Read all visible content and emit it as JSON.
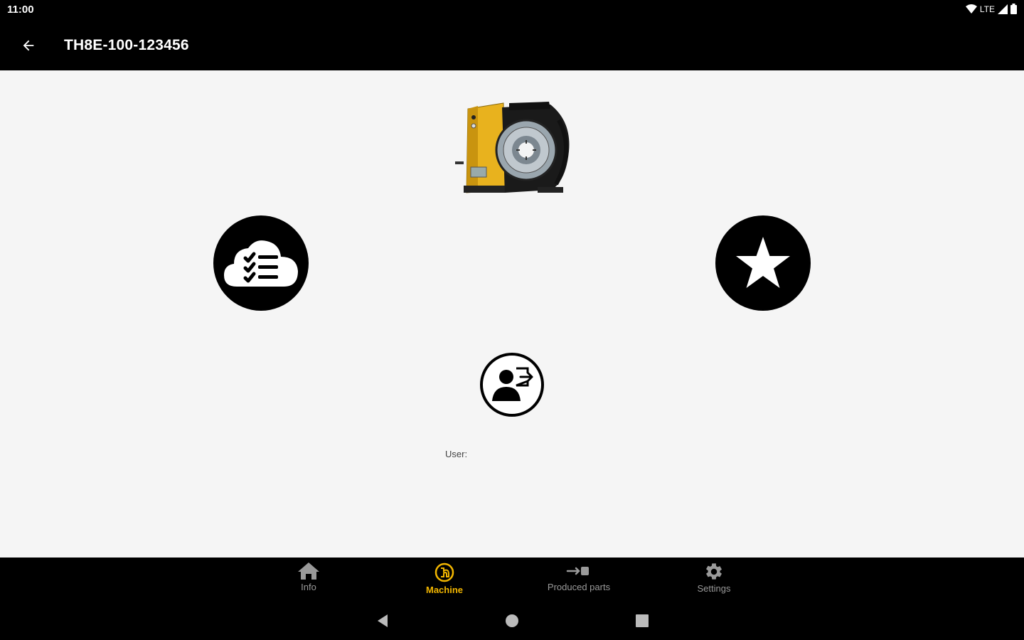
{
  "status_bar": {
    "time": "11:00",
    "network": "LTE"
  },
  "app_bar": {
    "title": "TH8E-100-123456",
    "back_icon": "arrow-back-icon"
  },
  "content": {
    "machine_image": "machine-image",
    "cloud_button_icon": "cloud-checklist-icon",
    "star_button_icon": "star-icon",
    "user_button_icon": "user-logout-icon",
    "user_label": "User:"
  },
  "bottom_nav": {
    "items": [
      {
        "label": "Info",
        "icon": "home-icon",
        "active": false
      },
      {
        "label": "Machine",
        "icon": "machine-icon",
        "active": true
      },
      {
        "label": "Produced parts",
        "icon": "produced-parts-icon",
        "active": false
      },
      {
        "label": "Settings",
        "icon": "gear-icon",
        "active": false
      }
    ]
  },
  "colors": {
    "accent": "#f2b600",
    "bar": "#000000",
    "background": "#f5f5f5",
    "inactive": "#9a9a9a"
  }
}
